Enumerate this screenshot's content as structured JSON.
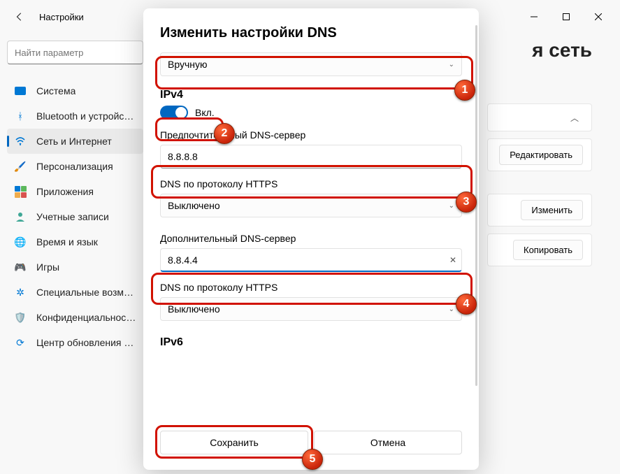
{
  "window": {
    "back_title": "Настройки",
    "search_placeholder": "Найти параметр",
    "heading_partial": "я сеть"
  },
  "sidebar": {
    "items": [
      {
        "label": "Система",
        "icon_color": "#0078d4",
        "selected": false
      },
      {
        "label": "Bluetooth и устройства",
        "icon": "bt",
        "selected": false
      },
      {
        "label": "Сеть и Интернет",
        "icon": "wifi",
        "selected": true
      },
      {
        "label": "Персонализация",
        "icon": "brush",
        "selected": false
      },
      {
        "label": "Приложения",
        "icon": "apps",
        "selected": false
      },
      {
        "label": "Учетные записи",
        "icon": "acct",
        "selected": false
      },
      {
        "label": "Время и язык",
        "icon": "time",
        "selected": false
      },
      {
        "label": "Игры",
        "icon": "game",
        "selected": false
      },
      {
        "label": "Специальные возможности",
        "icon": "access",
        "selected": false
      },
      {
        "label": "Конфиденциальность и защита",
        "icon": "shield",
        "selected": false
      },
      {
        "label": "Центр обновления Windows",
        "icon": "update",
        "selected": false
      }
    ]
  },
  "right": {
    "edit": "Редактировать",
    "change": "Изменить",
    "copy": "Копировать"
  },
  "modal": {
    "title": "Изменить настройки DNS",
    "mode_value": "Вручную",
    "ipv4_heading": "IPv4",
    "toggle_on_label": "Вкл.",
    "preferred_label": "Предпочтительный DNS-сервер",
    "preferred_value": "8.8.8.8",
    "doh_label": "DNS по протоколу HTTPS",
    "doh_value": "Выключено",
    "alt_label": "Дополнительный DNS-сервер",
    "alt_value": "8.8.4.4",
    "doh2_label": "DNS по протоколу HTTPS",
    "doh2_value": "Выключено",
    "ipv6_heading": "IPv6",
    "save": "Сохранить",
    "cancel": "Отмена"
  },
  "annotations": [
    "1",
    "2",
    "3",
    "4",
    "5"
  ]
}
